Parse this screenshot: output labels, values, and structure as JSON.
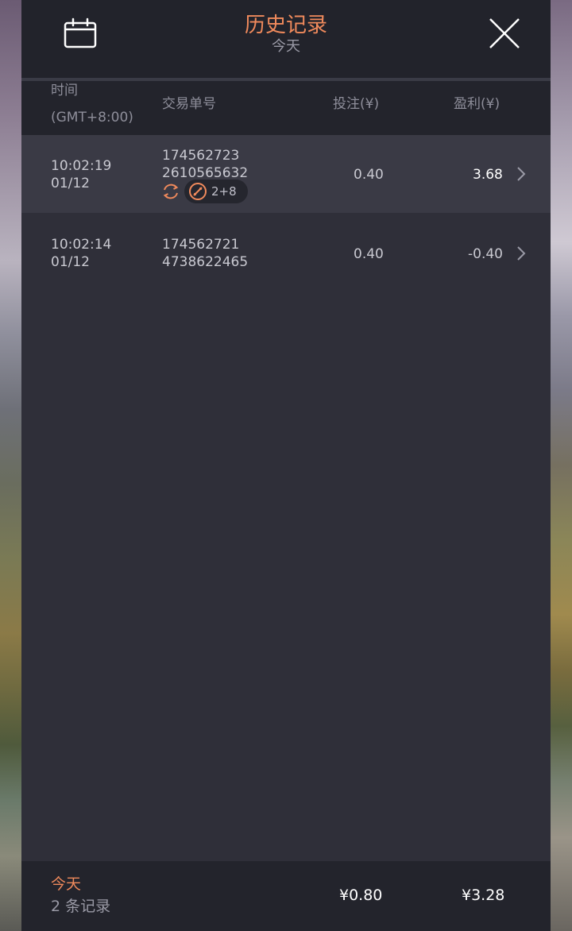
{
  "header": {
    "title": "历史记录",
    "subtitle": "今天",
    "calendar_icon": "calendar-icon",
    "close_icon": "close-icon",
    "accent_color": "#f08a5c"
  },
  "columns": {
    "time": "时间",
    "timezone": "(GMT+8:00)",
    "order_id": "交易单号",
    "bet": "投注(¥)",
    "profit": "盈利(¥)"
  },
  "rows": [
    {
      "time": "10:02:19",
      "date": "01/12",
      "order_line1": "174562723",
      "order_line2": "2610565632",
      "bet": "0.40",
      "profit": "3.68",
      "badges": {
        "refresh_icon": "refresh-icon",
        "ball_icon": "ball-icon",
        "label": "2+8"
      }
    },
    {
      "time": "10:02:14",
      "date": "01/12",
      "order_line1": "174562721",
      "order_line2": "4738622465",
      "bet": "0.40",
      "profit": "-0.40"
    }
  ],
  "footer": {
    "period": "今天",
    "count": "2 条记录",
    "total_bet": "¥0.80",
    "total_profit": "¥3.28"
  }
}
